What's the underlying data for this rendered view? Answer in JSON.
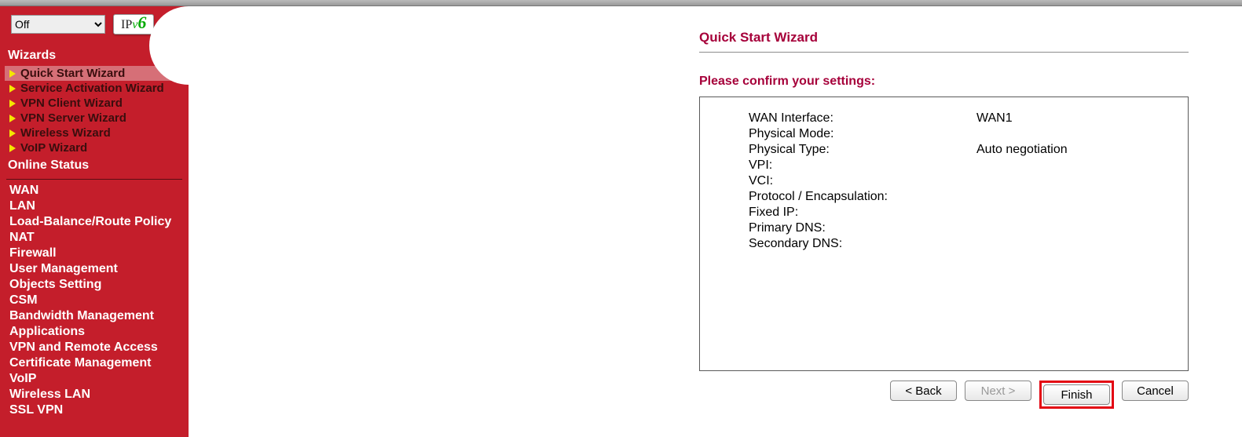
{
  "controls": {
    "mode_select": "Off",
    "ipv6_ip": "IP",
    "ipv6_v": "v",
    "ipv6_six": "6"
  },
  "nav": {
    "wizards_heading": "Wizards",
    "wizard_items": [
      {
        "label": "Quick Start Wizard"
      },
      {
        "label": "Service Activation Wizard"
      },
      {
        "label": "VPN Client Wizard"
      },
      {
        "label": "VPN Server Wizard"
      },
      {
        "label": "Wireless Wizard"
      },
      {
        "label": "VoIP Wizard"
      }
    ],
    "online_status_heading": "Online Status",
    "menu": [
      "WAN",
      "LAN",
      "Load-Balance/Route Policy",
      "NAT",
      "Firewall",
      "User Management",
      "Objects Setting",
      "CSM",
      "Bandwidth Management",
      "Applications",
      "VPN and Remote Access",
      "Certificate Management",
      "VoIP",
      "Wireless LAN",
      "SSL VPN"
    ]
  },
  "page": {
    "title": "Quick Start Wizard",
    "subtitle": "Please confirm your settings:",
    "settings": [
      {
        "k": "WAN Interface:",
        "v": "WAN1"
      },
      {
        "k": "Physical Mode:",
        "v": ""
      },
      {
        "k": "Physical Type:",
        "v": "Auto negotiation"
      },
      {
        "k": "VPI:",
        "v": ""
      },
      {
        "k": "VCI:",
        "v": ""
      },
      {
        "k": "Protocol / Encapsulation:",
        "v": ""
      },
      {
        "k": "Fixed IP:",
        "v": ""
      },
      {
        "k": "Primary DNS:",
        "v": ""
      },
      {
        "k": "Secondary DNS:",
        "v": ""
      }
    ],
    "buttons": {
      "back": "< Back",
      "next": "Next >",
      "finish": "Finish",
      "cancel": "Cancel"
    }
  }
}
